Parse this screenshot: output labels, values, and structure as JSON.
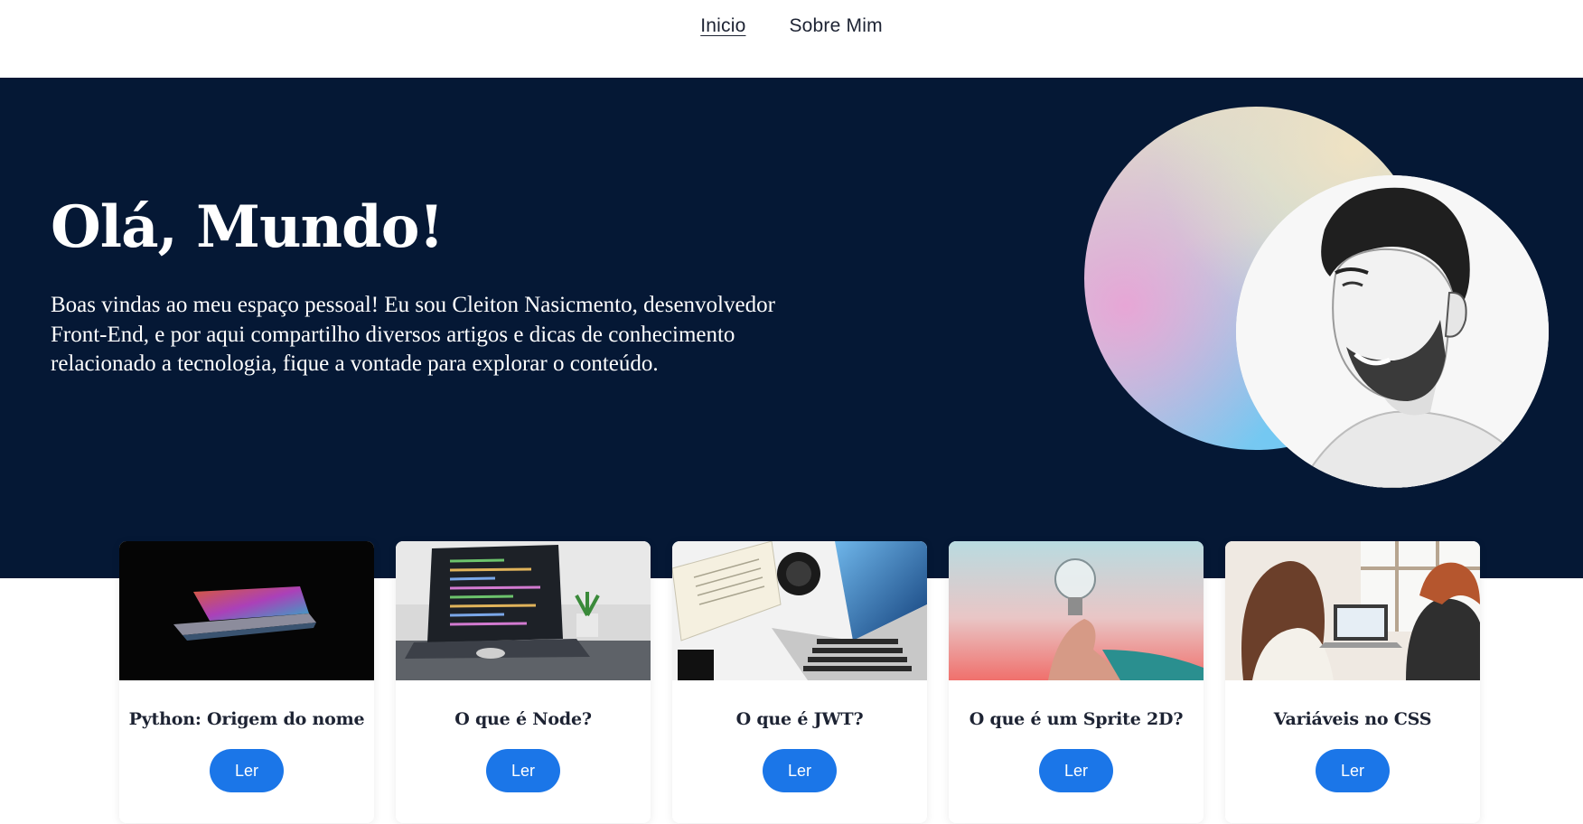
{
  "nav": {
    "items": [
      {
        "label": "Inicio"
      },
      {
        "label": "Sobre Mim"
      }
    ]
  },
  "hero": {
    "title": "Olá, Mundo!",
    "text": "Boas vindas ao meu espaço pessoal! Eu sou Cleiton Nasicmento, desenvolvedor Front-End, e por aqui compartilho diversos artigos e dicas de conhecimento relacionado a tecnologia, fique a vontade para explorar o conteúdo."
  },
  "cards": [
    {
      "title": "Python: Origem do nome",
      "button": "Ler",
      "image": "laptop-dark-image"
    },
    {
      "title": "O que é Node?",
      "button": "Ler",
      "image": "code-laptop-image"
    },
    {
      "title": "O que é JWT?",
      "button": "Ler",
      "image": "desk-laptop-image"
    },
    {
      "title": "O que é um Sprite 2D?",
      "button": "Ler",
      "image": "lightbulb-image"
    },
    {
      "title": "Variáveis no CSS",
      "button": "Ler",
      "image": "people-laptop-image"
    }
  ],
  "colors": {
    "hero_bg": "#051835",
    "button": "#1b76e8",
    "text_dark": "#1d2333"
  }
}
